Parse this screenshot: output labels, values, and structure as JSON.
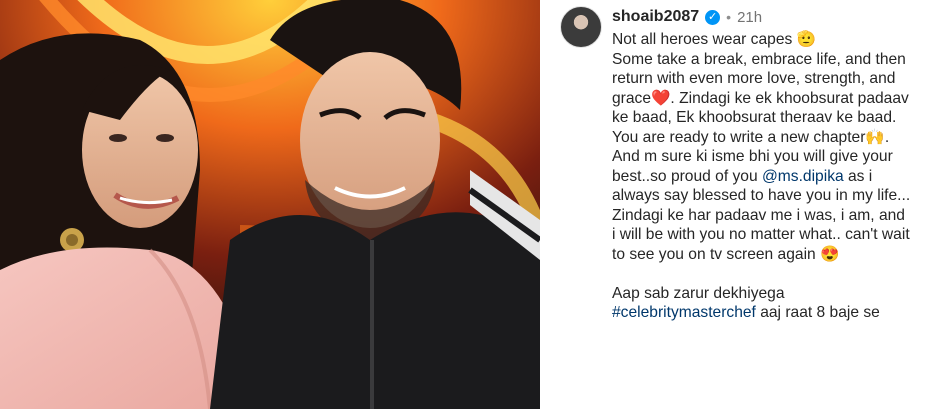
{
  "post": {
    "username": "shoaib2087",
    "time_ago": "21h",
    "separator": "•",
    "verified_badge_icon": "check-icon",
    "caption": {
      "line1": "Not all heroes wear capes 🫡",
      "part2": "Some take a break, embrace life, and then return with even more love, strength, and grace❤️. Zindagi ke ek khoobsurat padaav ke baad, Ek khoobsurat theraav ke baad. You are ready to write a new chapter🙌. And m sure ki isme bhi you will give your best..so proud of you ",
      "mention": "@ms.dipika",
      "part3": " as i always say blessed to have you in my life... Zindagi ke har padaav me i was, i am, and i will be with you no matter what.. can't wait to see you on tv screen again 😍",
      "part4": "Aap sab zarur dekhiyega",
      "hashtag": "#celebritymasterchef",
      "part5": " aaj raat 8 baje se"
    }
  },
  "colors": {
    "link": "#00376b",
    "verified": "#0095f6",
    "text": "#262626",
    "muted": "#737373"
  }
}
